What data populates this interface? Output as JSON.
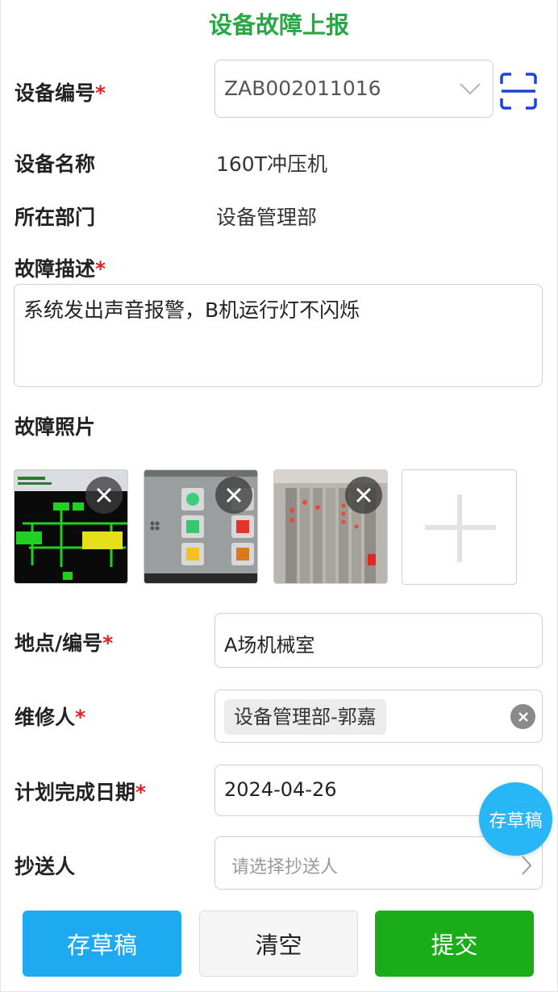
{
  "header": {
    "title": "设备故障上报"
  },
  "device_number": {
    "label": "设备编号",
    "required_mark": "*",
    "value": "ZAB002011016"
  },
  "device_name": {
    "label": "设备名称",
    "value": "160T冲压机"
  },
  "department": {
    "label": "所在部门",
    "value": "设备管理部"
  },
  "fault_description": {
    "label": "故障描述",
    "required_mark": "*",
    "value": "系统发出声音报警，B机运行灯不闪烁"
  },
  "fault_photos": {
    "label": "故障照片",
    "photos": [
      {
        "name": "control-screen-photo"
      },
      {
        "name": "panel-buttons-photo"
      },
      {
        "name": "equipment-rack-photo"
      }
    ]
  },
  "location": {
    "label": "地点/编号",
    "required_mark": "*",
    "value": "A场机械室"
  },
  "repairer": {
    "label": "维修人",
    "required_mark": "*",
    "value": "设备管理部-郭嘉"
  },
  "planned_date": {
    "label": "计划完成日期",
    "required_mark": "*",
    "value": "2024-04-26"
  },
  "cc": {
    "label": "抄送人",
    "placeholder": "请选择抄送人"
  },
  "floating_draft": {
    "label": "存草稿"
  },
  "actions": {
    "draft": "存草稿",
    "clear": "清空",
    "submit": "提交"
  },
  "colors": {
    "title": "#28a745",
    "required": "#e02020",
    "draft_button": "#1eaaf1",
    "submit_button": "#1aad19",
    "scan_icon": "#1a44d8"
  }
}
